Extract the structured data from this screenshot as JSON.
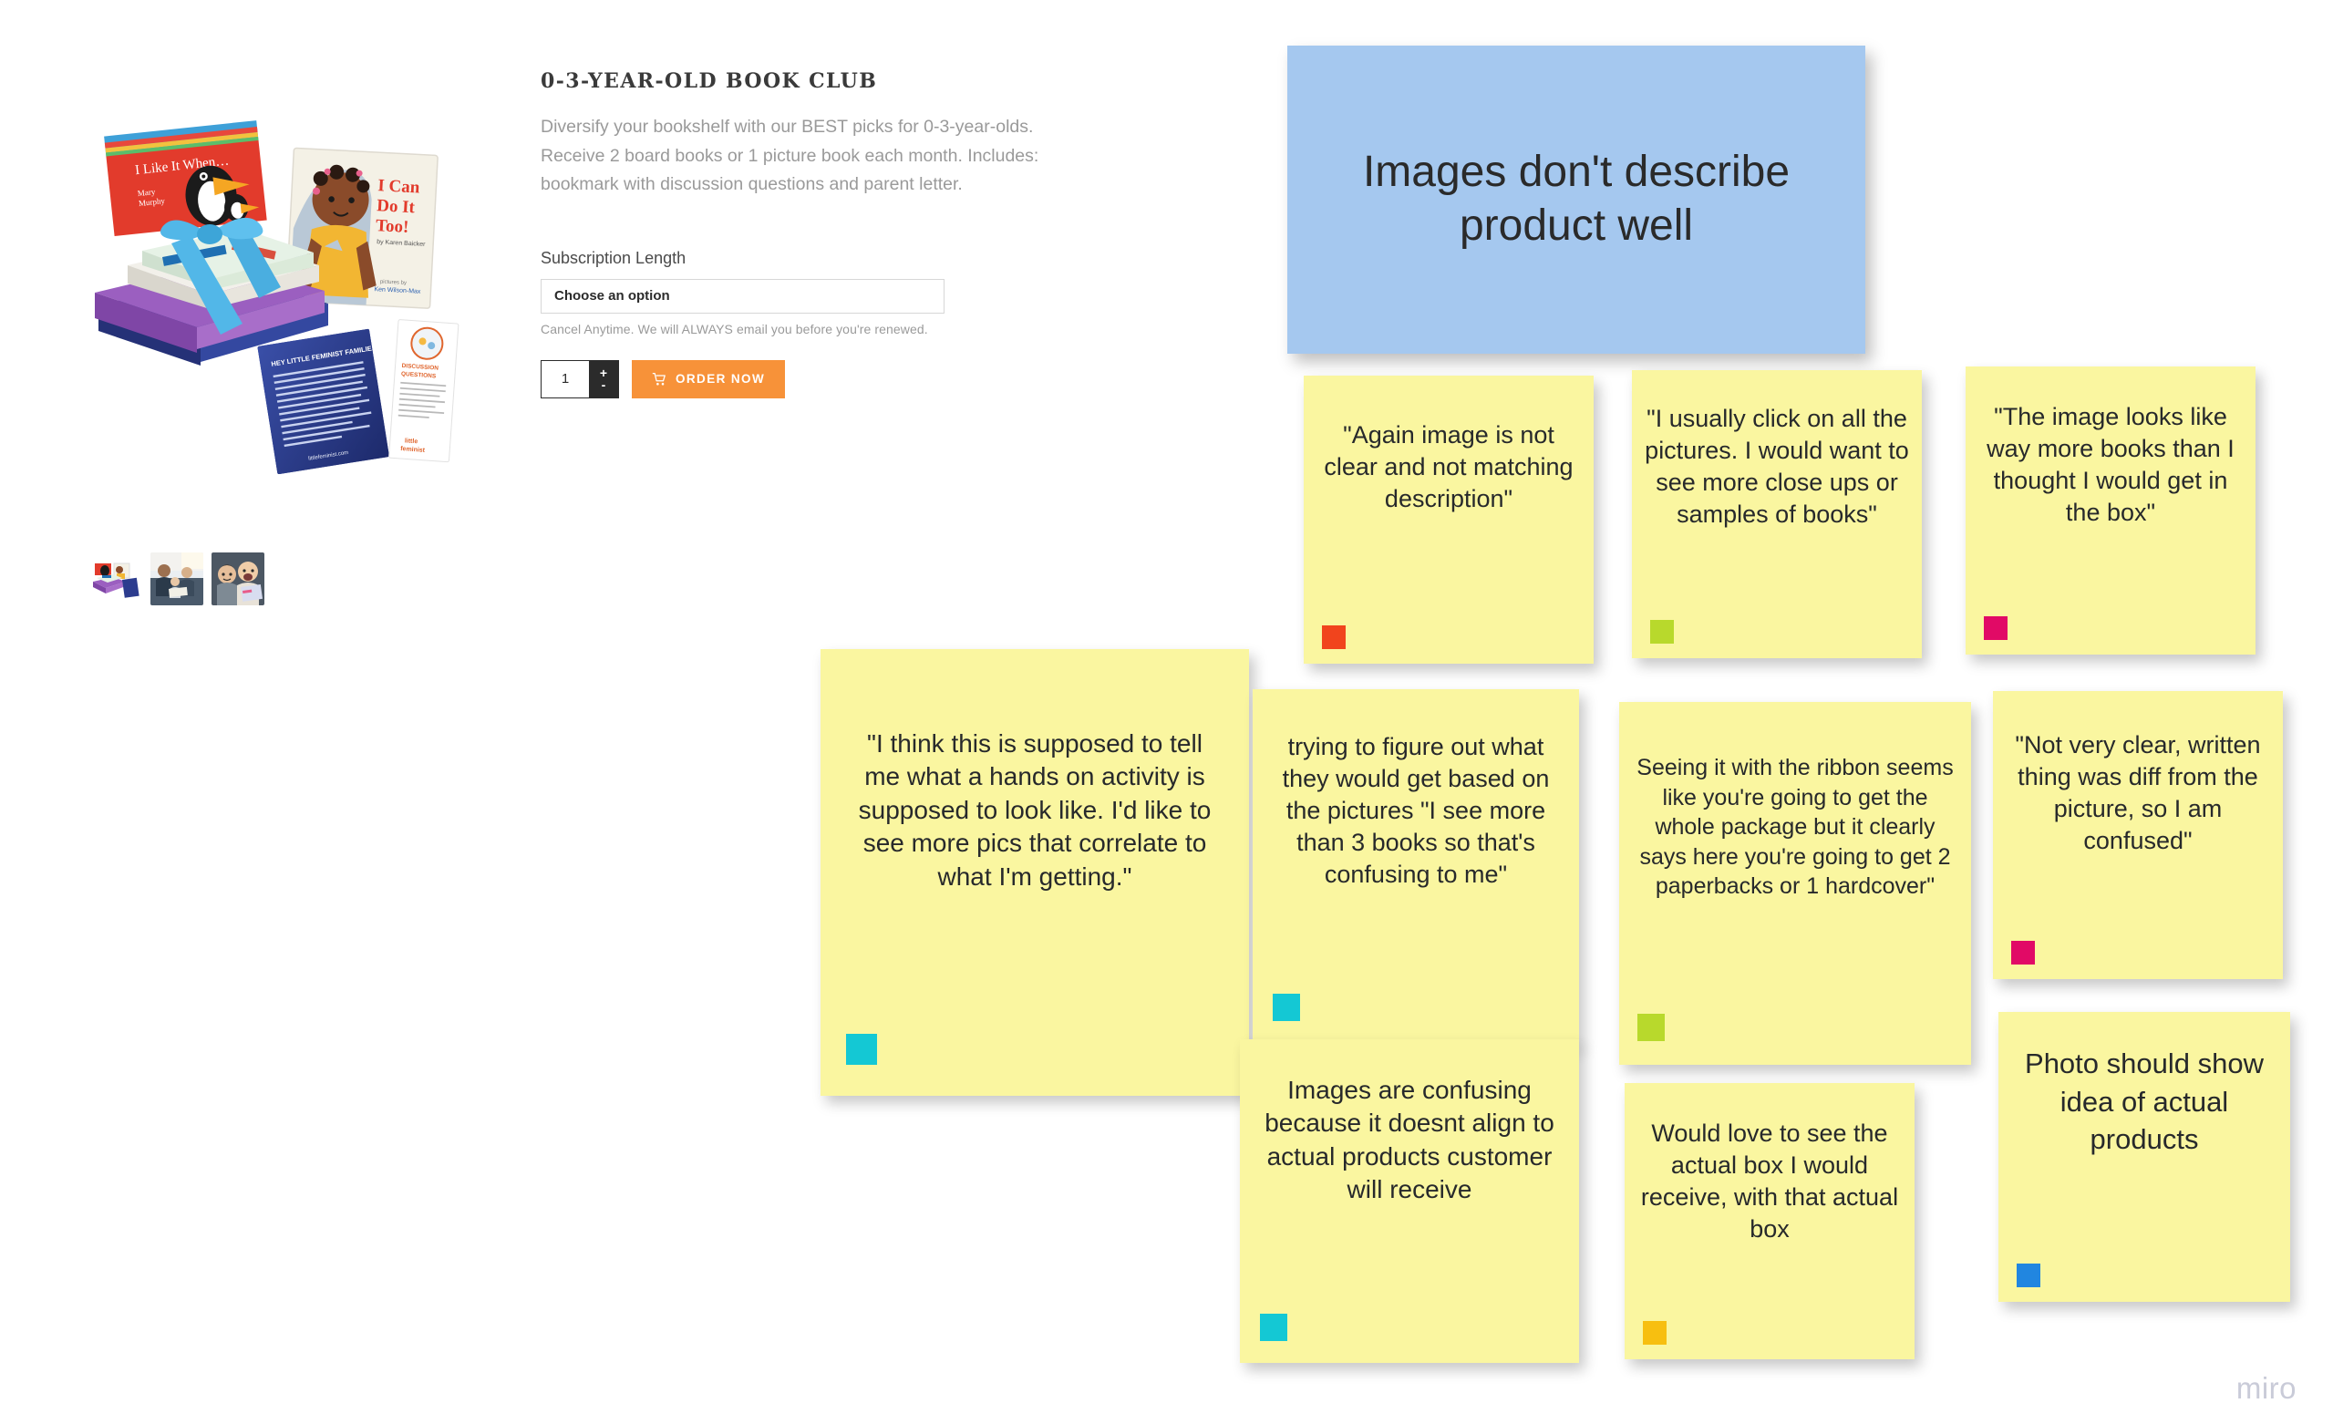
{
  "product": {
    "title": "0-3-YEAR-OLD BOOK CLUB",
    "description": "Diversify your bookshelf with our BEST picks for 0-3-year-olds. Receive 2 board books or 1 picture book each month. Includes: bookmark with discussion questions and parent letter.",
    "subscription_label": "Subscription Length",
    "subscription_value": "Choose an option",
    "cancel_note": "Cancel Anytime. We will ALWAYS email you before you're renewed.",
    "quantity": "1",
    "stepper_plus": "+",
    "stepper_minus": "-",
    "order_button": "ORDER NOW",
    "hero_book_1": "I Like It When...",
    "hero_book_1_author": "Mary Murphy",
    "hero_book_2": "I Can Do It Too!",
    "hero_book_2_author": "by Karen Baicker"
  },
  "board": {
    "watermark": "miro",
    "header_note": {
      "text": "Images don't describe product well",
      "color": "#a5c8ef"
    },
    "notes": [
      {
        "id": "note-again-image",
        "text": "\"Again image is not clear and not matching description\"",
        "tag_color": "#f1441d",
        "tag_name": "red-tag"
      },
      {
        "id": "note-usually-click",
        "text": "\"I usually click on all the pictures. I would want to see more close ups or samples of books\"",
        "tag_color": "#b8d92c",
        "tag_name": "green-tag"
      },
      {
        "id": "note-way-more-books",
        "text": "\"The image looks like way more books than I thought I would get in the box\"",
        "tag_color": "#e10a66",
        "tag_name": "magenta-tag"
      },
      {
        "id": "note-hands-on-activity",
        "text": "\"I think this is supposed to tell me what a hands on activity is supposed to look like. I'd like to see more pics that correlate to what I'm getting.\"",
        "tag_color": "#14c8d4",
        "tag_name": "cyan-tag"
      },
      {
        "id": "note-trying-to-figure-out",
        "text": "trying to figure out what they would get based on the pictures \"I see more than 3 books so that's confusing to me\"",
        "tag_color": "#14c8d4",
        "tag_name": "cyan-tag"
      },
      {
        "id": "note-seeing-ribbon",
        "text": "Seeing it with the ribbon seems like you're going to get the whole package but it clearly says here you're going to get 2 paperbacks or 1 hardcover\"",
        "tag_color": "#b8d92c",
        "tag_name": "green-tag"
      },
      {
        "id": "note-not-very-clear",
        "text": "\"Not very clear, written thing was diff from the picture, so I am confused\"",
        "tag_color": "#e10a66",
        "tag_name": "magenta-tag"
      },
      {
        "id": "note-images-confusing",
        "text": "Images are confusing because it doesnt align to actual products customer will receive",
        "tag_color": "#14c8d4",
        "tag_name": "cyan-tag"
      },
      {
        "id": "note-actual-box",
        "text": "Would love to see the actual box I would receive, with that actual box",
        "tag_color": "#f7bf10",
        "tag_name": "yellow-tag"
      },
      {
        "id": "note-photo-should-show",
        "text": "Photo should show idea of actual products",
        "tag_color": "#2186e0",
        "tag_name": "blue-tag"
      }
    ]
  }
}
